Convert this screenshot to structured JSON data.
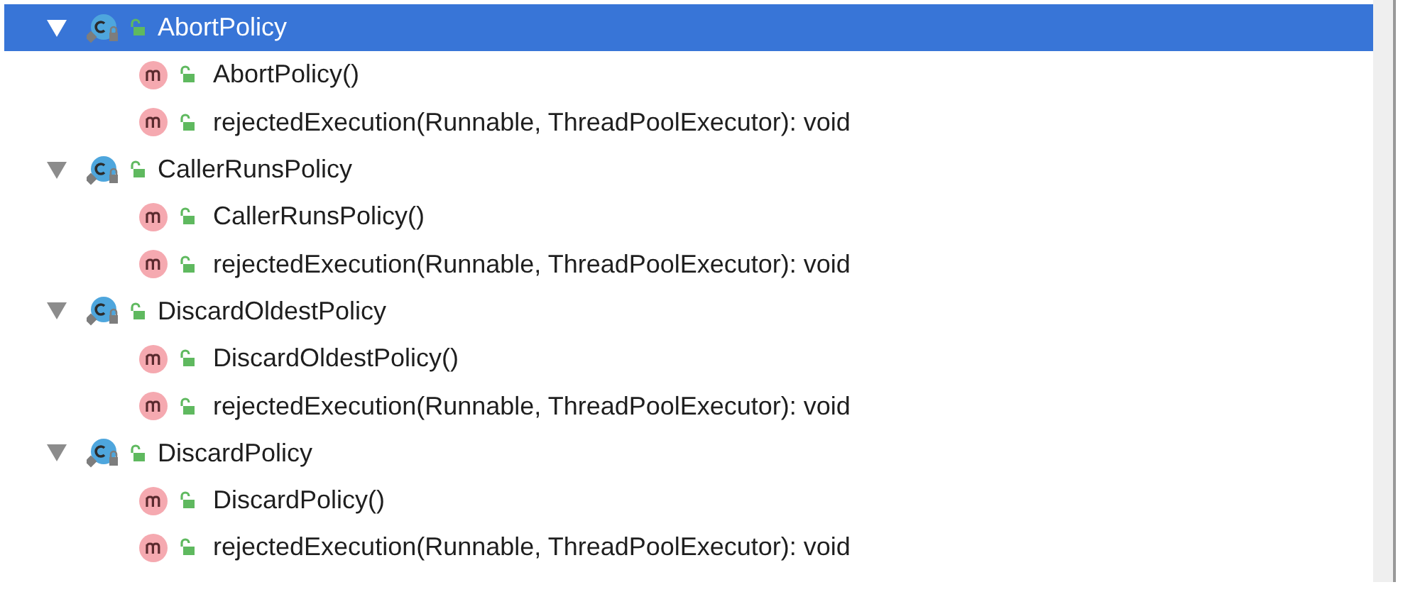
{
  "tree": [
    {
      "name": "AbortPolicy",
      "selected": true,
      "expanded": true,
      "children": [
        {
          "name": "AbortPolicy()",
          "selected": false
        },
        {
          "name": "rejectedExecution(Runnable, ThreadPoolExecutor): void",
          "selected": false
        }
      ]
    },
    {
      "name": "CallerRunsPolicy",
      "selected": false,
      "expanded": true,
      "children": [
        {
          "name": "CallerRunsPolicy()",
          "selected": false
        },
        {
          "name": "rejectedExecution(Runnable, ThreadPoolExecutor): void",
          "selected": false
        }
      ]
    },
    {
      "name": "DiscardOldestPolicy",
      "selected": false,
      "expanded": true,
      "children": [
        {
          "name": "DiscardOldestPolicy()",
          "selected": false
        },
        {
          "name": "rejectedExecution(Runnable, ThreadPoolExecutor): void",
          "selected": false
        }
      ]
    },
    {
      "name": "DiscardPolicy",
      "selected": false,
      "expanded": true,
      "children": [
        {
          "name": "DiscardPolicy()",
          "selected": false
        },
        {
          "name": "rejectedExecution(Runnable, ThreadPoolExecutor): void",
          "selected": false
        }
      ]
    }
  ]
}
